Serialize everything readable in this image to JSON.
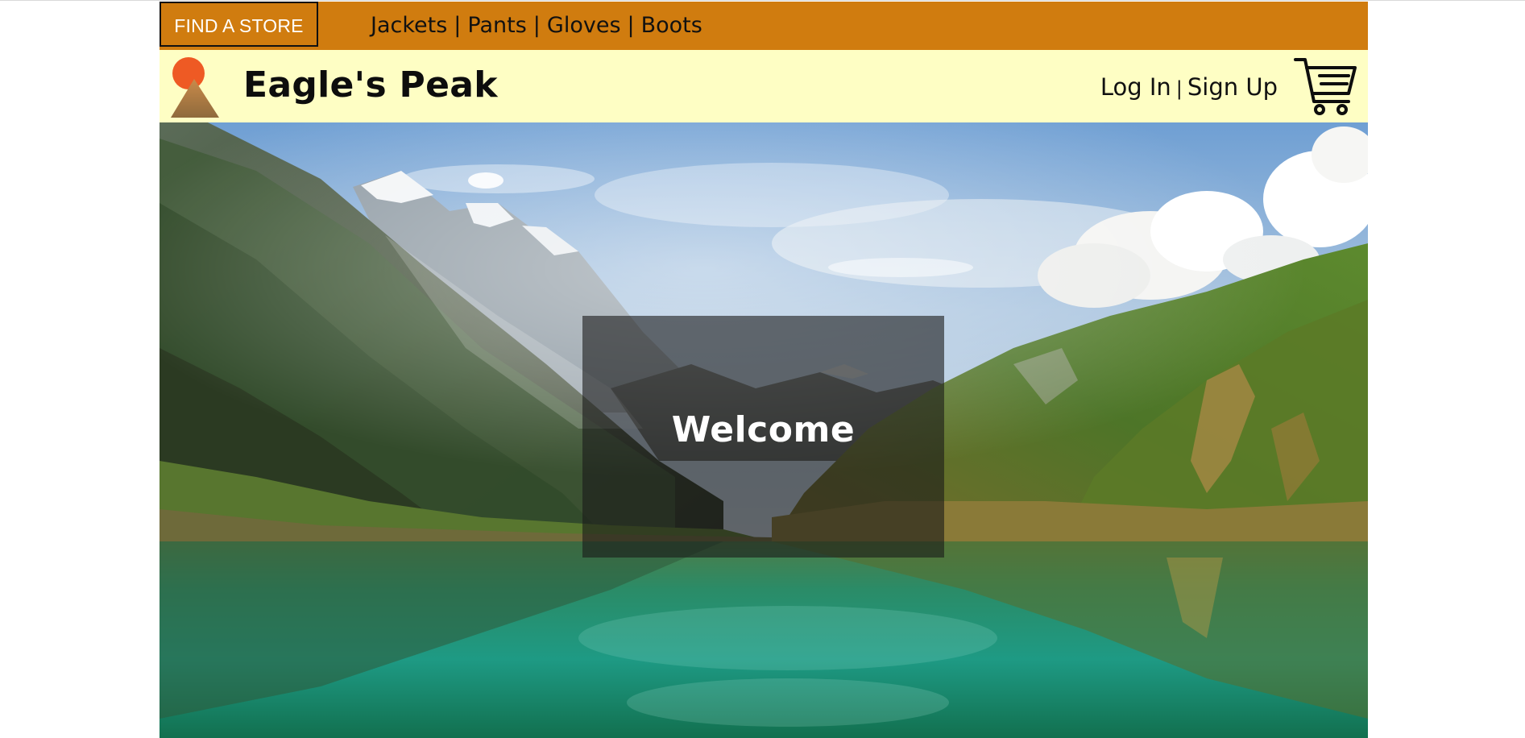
{
  "topbar": {
    "find_store_label": "FIND A STORE",
    "nav_items": [
      "Jackets",
      "Pants",
      "Gloves",
      "Boots"
    ],
    "separator": "|",
    "background_color": "#d07c0f"
  },
  "brandbar": {
    "brand_name": "Eagle's Peak",
    "login_label": "Log In",
    "auth_separator": "|",
    "signup_label": "Sign Up",
    "background_color": "#fefec4",
    "logo_icon": "sun-mountain-logo",
    "cart_icon": "shopping-cart-icon"
  },
  "hero": {
    "welcome_text": "Welcome",
    "image_subject": "mountain-lake-landscape"
  },
  "colors": {
    "accent_orange": "#d07c0f",
    "brand_yellow": "#fefec4",
    "logo_sun": "#ee5a24",
    "logo_mountain": "#a47a45"
  }
}
